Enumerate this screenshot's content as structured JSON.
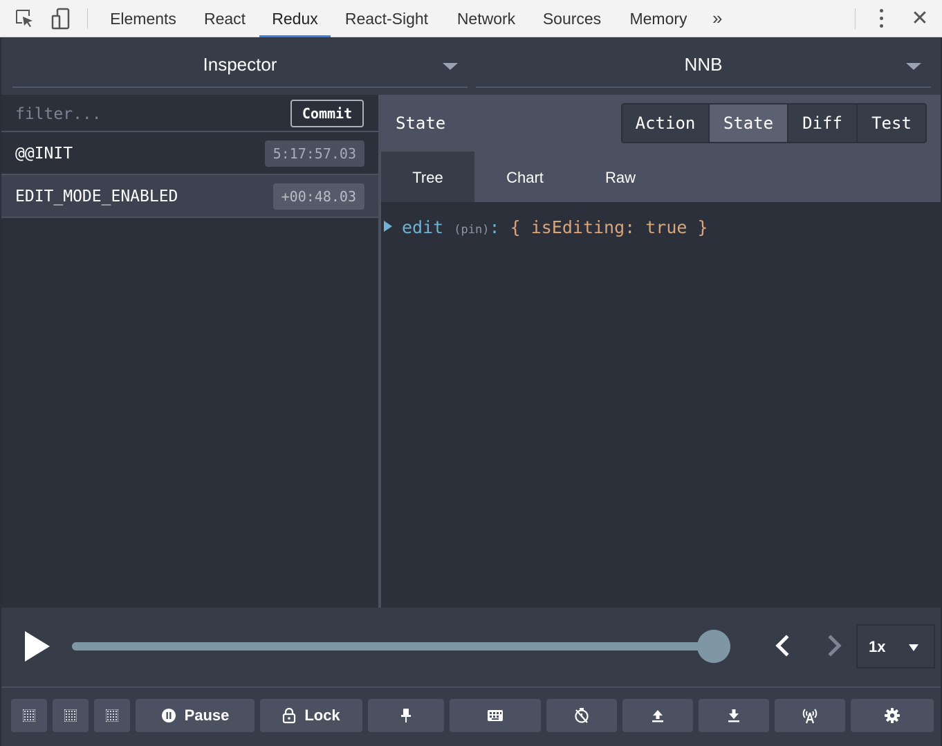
{
  "devtools": {
    "tabs": [
      {
        "label": "Elements"
      },
      {
        "label": "React"
      },
      {
        "label": "Redux"
      },
      {
        "label": "React-Sight"
      },
      {
        "label": "Network"
      },
      {
        "label": "Sources"
      },
      {
        "label": "Memory"
      }
    ],
    "active_tab": "Redux",
    "more_tabs_label": "»",
    "close_label": "✕",
    "icons": [
      "inspect-element-icon",
      "device-toolbar-icon",
      "kebab-menu-icon",
      "close-icon"
    ]
  },
  "monitor": {
    "selector_label": "Inspector",
    "instance_label": "NNB"
  },
  "actions": {
    "filter_placeholder": "filter...",
    "commit_label": "Commit",
    "items": [
      {
        "name": "@@INIT",
        "time": "5:17:57.03",
        "selected": false
      },
      {
        "name": "EDIT_MODE_ENABLED",
        "time": "+00:48.03",
        "selected": true
      }
    ]
  },
  "inspector": {
    "title": "State",
    "modes": [
      {
        "label": "Action",
        "active": false
      },
      {
        "label": "State",
        "active": true
      },
      {
        "label": "Diff",
        "active": false
      },
      {
        "label": "Test",
        "active": false
      }
    ],
    "views": [
      {
        "label": "Tree",
        "active": true
      },
      {
        "label": "Chart",
        "active": false
      },
      {
        "label": "Raw",
        "active": false
      }
    ],
    "tree": {
      "key": "edit",
      "annotation": "(pin)",
      "colon": ":",
      "value": "{ isEditing: true }"
    }
  },
  "slider": {
    "position_fraction": 1.0,
    "speed": "1x",
    "play_icon": "play-icon",
    "prev_icon": "previous-icon",
    "next_icon": "next-icon"
  },
  "toolbar": {
    "pause_label": "Pause",
    "lock_label": "Lock",
    "buttons": [
      "dock-left-icon",
      "dock-right-icon",
      "dock-bottom-icon",
      "pause-icon",
      "lock-icon",
      "pin-icon",
      "keyboard-icon",
      "persist-timer-icon",
      "export-icon",
      "import-icon",
      "remote-icon",
      "settings-icon"
    ]
  },
  "colors": {
    "panel_bg": "#2b303b",
    "header_bg": "#4b5160",
    "toolbar_bg": "#363c48",
    "tree_key": "#6fb3d2",
    "tree_value": "#d9a57a",
    "active_tab_underline": "#3b7de3",
    "slider": "#7f97a4"
  }
}
